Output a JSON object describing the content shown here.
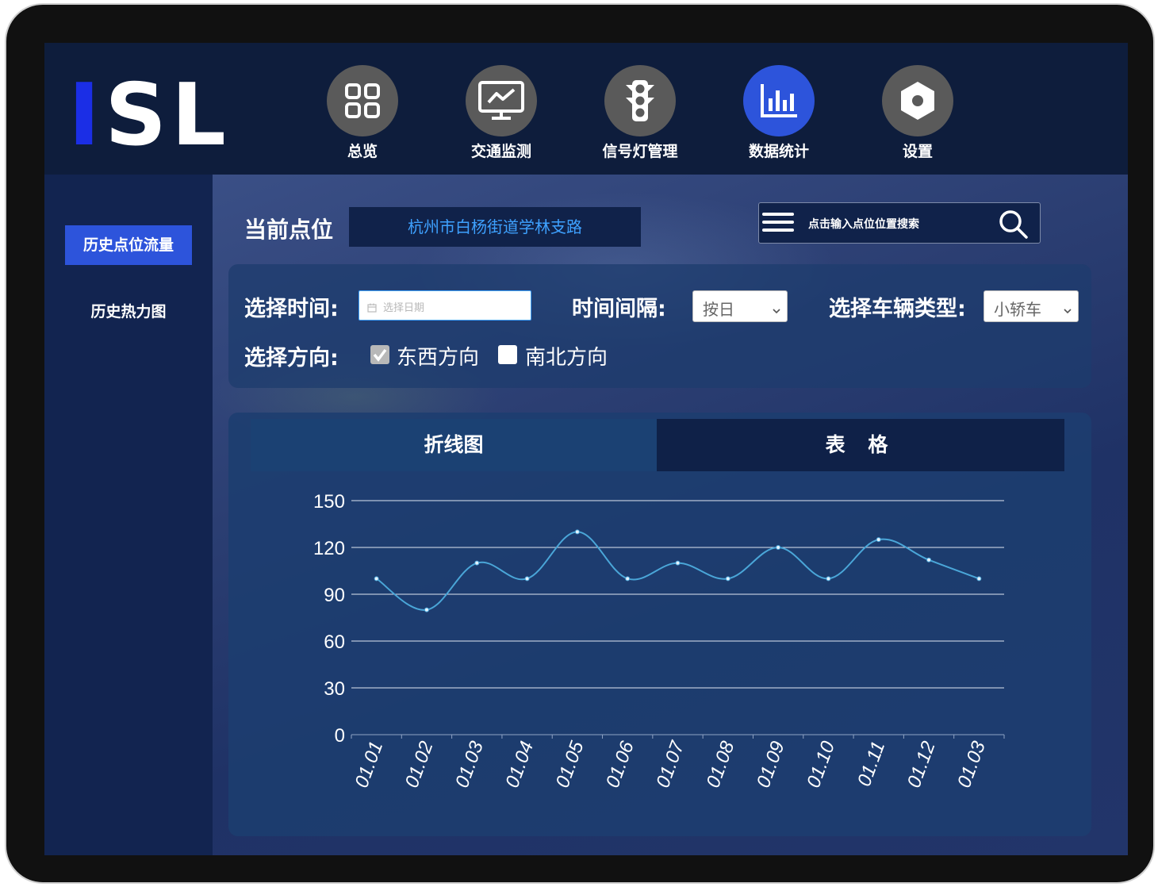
{
  "logo": {
    "part1": "I",
    "part2": "SL"
  },
  "nav": [
    {
      "label": "总览",
      "icon": "grid-icon",
      "active": false
    },
    {
      "label": "交通监测",
      "icon": "monitor-icon",
      "active": false
    },
    {
      "label": "信号灯管理",
      "icon": "traffic-light-icon",
      "active": false
    },
    {
      "label": "数据统计",
      "icon": "bar-chart-icon",
      "active": true
    },
    {
      "label": "设置",
      "icon": "hexagon-gear-icon",
      "active": false
    }
  ],
  "sidebar": {
    "items": [
      {
        "label": "历史点位流量",
        "active": true
      },
      {
        "label": "历史热力图",
        "active": false
      }
    ]
  },
  "location": {
    "label": "当前点位",
    "value": "杭州市白杨街道学林支路"
  },
  "search": {
    "placeholder": "点击输入点位位置搜索"
  },
  "filters": {
    "time_label": "选择时间:",
    "date_placeholder": "选择日期",
    "interval_label": "时间间隔:",
    "interval_value": "按日",
    "vehicle_label": "选择车辆类型:",
    "vehicle_value": "小轿车",
    "direction_label": "选择方向:",
    "directions": [
      {
        "label": "东西方向",
        "checked": true
      },
      {
        "label": "南北方向",
        "checked": false
      }
    ]
  },
  "tabs": [
    {
      "label": "折线图",
      "active": true
    },
    {
      "label": "表 格",
      "active": false
    }
  ],
  "colors": {
    "accent": "#2d54db",
    "line": "#4aa6d8",
    "location_text": "#3ea1ff"
  },
  "chart_data": {
    "type": "line",
    "categories": [
      "01.01",
      "01.02",
      "01.03",
      "01.04",
      "01.05",
      "01.06",
      "01.07",
      "01.08",
      "01.09",
      "01.10",
      "01.11",
      "01.12",
      "01.03"
    ],
    "series": [
      {
        "values": [
          100,
          80,
          110,
          100,
          130,
          100,
          110,
          100,
          120,
          100,
          125,
          112,
          100
        ]
      }
    ],
    "ylim": [
      0,
      150
    ],
    "yticks": [
      0,
      30,
      60,
      90,
      120,
      150
    ],
    "grid": true,
    "smooth": true
  }
}
